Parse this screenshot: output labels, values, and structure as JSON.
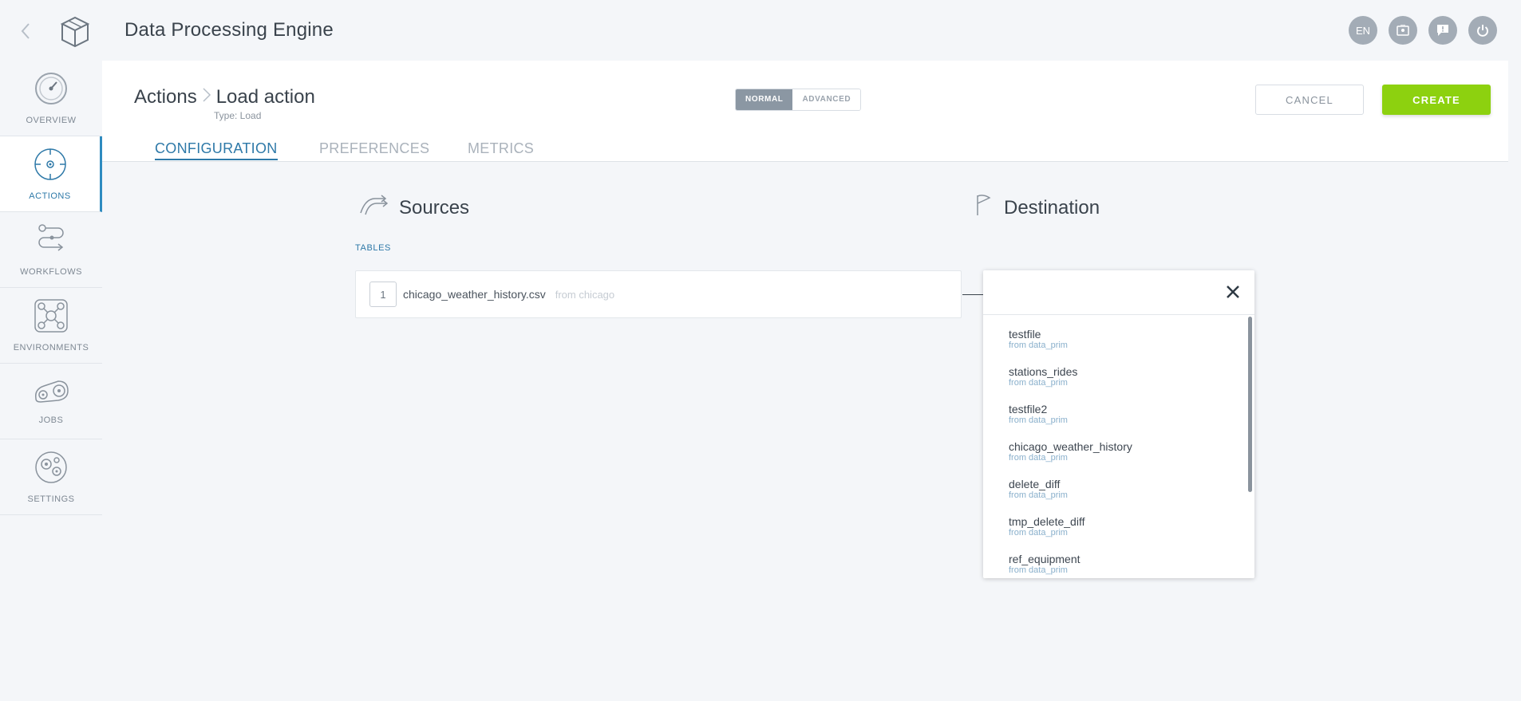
{
  "app": {
    "title": "Data Processing Engine"
  },
  "top_actions": {
    "language": "EN"
  },
  "sidebar": {
    "items": [
      {
        "label": "OVERVIEW",
        "icon": "gauge-icon"
      },
      {
        "label": "ACTIONS",
        "icon": "target-icon",
        "active": true
      },
      {
        "label": "WORKFLOWS",
        "icon": "workflow-icon"
      },
      {
        "label": "ENVIRONMENTS",
        "icon": "network-icon"
      },
      {
        "label": "JOBS",
        "icon": "gears-icon"
      },
      {
        "label": "SETTINGS",
        "icon": "settings-icon"
      }
    ]
  },
  "header": {
    "breadcrumb_root": "Actions",
    "breadcrumb_current": "Load action",
    "type_label": "Type: Load",
    "mode_normal": "NORMAL",
    "mode_advanced": "ADVANCED",
    "cancel_label": "CANCEL",
    "create_label": "CREATE"
  },
  "tabs": [
    "CONFIGURATION",
    "PREFERENCES",
    "METRICS"
  ],
  "sources": {
    "title": "Sources",
    "tables_label": "TABLES",
    "items": [
      {
        "index": "1",
        "name": "chicago_weather_history.csv",
        "from": "from chicago"
      }
    ]
  },
  "destination": {
    "title": "Destination",
    "options": [
      {
        "name": "testfile",
        "from": "from data_prim"
      },
      {
        "name": "stations_rides",
        "from": "from data_prim"
      },
      {
        "name": "testfile2",
        "from": "from data_prim"
      },
      {
        "name": "chicago_weather_history",
        "from": "from data_prim"
      },
      {
        "name": "delete_diff",
        "from": "from data_prim"
      },
      {
        "name": "tmp_delete_diff",
        "from": "from data_prim"
      },
      {
        "name": "ref_equipment",
        "from": "from data_prim"
      }
    ]
  },
  "colors": {
    "accent": "#2e79a8",
    "create": "#8dd10f",
    "background": "#f4f6f9"
  }
}
